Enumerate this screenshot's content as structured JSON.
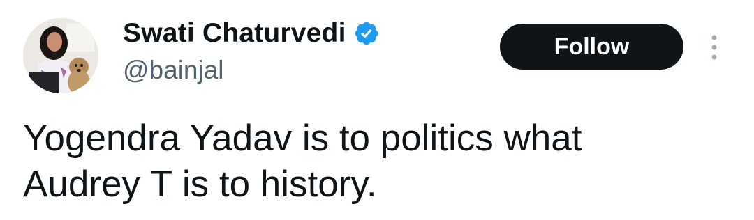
{
  "author": {
    "display_name": "Swati Chaturvedi",
    "handle": "@bainjal",
    "verified": true,
    "avatar_icon": "profile-photo-icon"
  },
  "actions": {
    "follow_label": "Follow",
    "more_icon": "more-vertical-icon"
  },
  "tweet": {
    "text": "Yogendra Yadav is to politics what\nAudrey T is to history."
  },
  "colors": {
    "text_primary": "#0f1419",
    "text_secondary": "#536471",
    "verified_badge": "#1d9bf0",
    "follow_bg": "#0f1419",
    "follow_text": "#ffffff",
    "background": "#ffffff"
  }
}
